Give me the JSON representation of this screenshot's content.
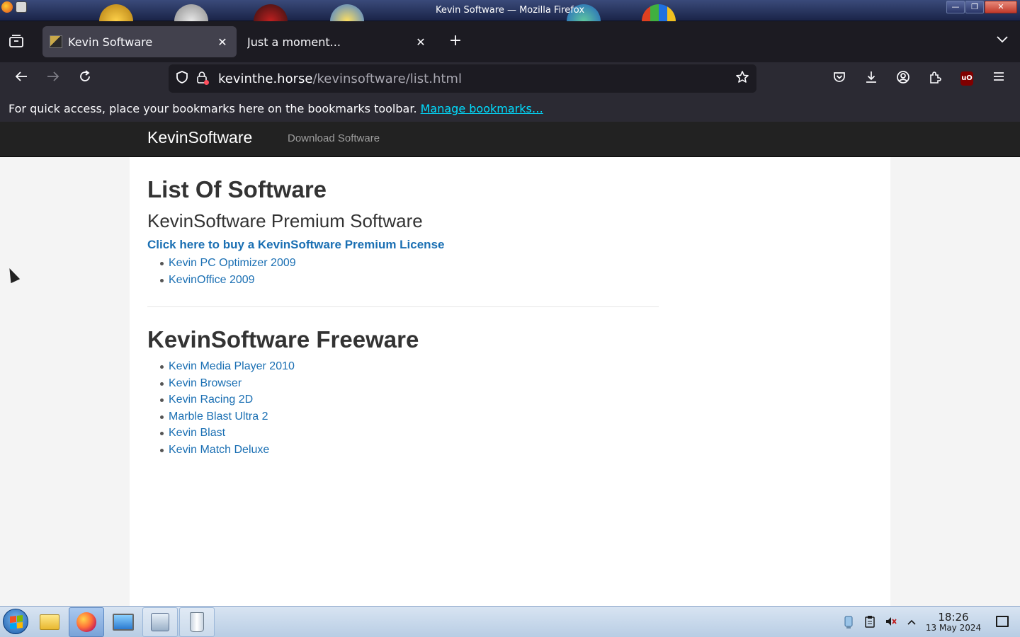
{
  "window": {
    "title": "Kevin Software — Mozilla Firefox",
    "minimize_label": "—",
    "maximize_label": "❐",
    "close_label": "✕"
  },
  "tabs": [
    {
      "label": "Kevin Software",
      "active": true
    },
    {
      "label": "Just a moment...",
      "active": false
    }
  ],
  "urlbar": {
    "host": "kevinthe.horse",
    "path": "/kevinsoftware/list.html"
  },
  "bookmarks_bar": {
    "message": "For quick access, place your bookmarks here on the bookmarks toolbar.",
    "link": "Manage bookmarks…"
  },
  "site": {
    "brand": "KevinSoftware",
    "nav_link": "Download Software"
  },
  "page": {
    "title": "List Of Software",
    "premium_heading": "KevinSoftware Premium Software",
    "buy_link": "Click here to buy a KevinSoftware Premium License",
    "premium_items": [
      "Kevin PC Optimizer 2009",
      "KevinOffice 2009"
    ],
    "freeware_heading": "KevinSoftware Freeware",
    "freeware_items": [
      "Kevin Media Player 2010",
      "Kevin Browser",
      "Kevin Racing 2D",
      "Marble Blast Ultra 2",
      "Kevin Blast",
      "Kevin Match Deluxe"
    ]
  },
  "taskbar": {
    "time": "18:26",
    "date": "13 May 2024"
  },
  "colors": {
    "link": "#1a6fb3",
    "navbar": "#222222",
    "firefox_chrome": "#2b2a33",
    "accent_link": "#00ddff"
  }
}
